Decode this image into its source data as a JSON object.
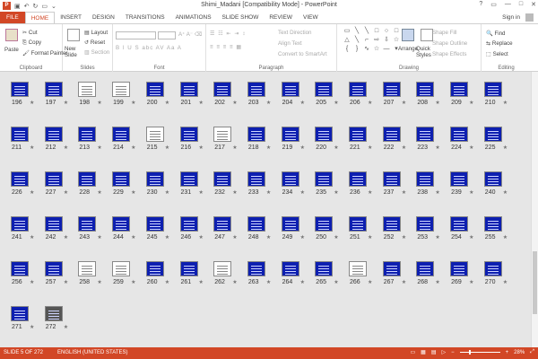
{
  "window": {
    "title": "Shimi_Madani [Compatibility Mode] - PowerPoint",
    "controls": [
      "?",
      "▭",
      "—",
      "□",
      "✕"
    ]
  },
  "tabs": [
    "FILE",
    "HOME",
    "INSERT",
    "DESIGN",
    "TRANSITIONS",
    "ANIMATIONS",
    "SLIDE SHOW",
    "REVIEW",
    "VIEW"
  ],
  "active_tab": "HOME",
  "sign_in": "Sign in",
  "ribbon": {
    "clipboard": {
      "paste": "Paste",
      "cut": "Cut",
      "copy": "Copy",
      "format_painter": "Format Painter",
      "group": "Clipboard"
    },
    "slides": {
      "new_slide": "New Slide",
      "layout": "Layout",
      "reset": "Reset",
      "section": "Section",
      "group": "Slides"
    },
    "font": {
      "group": "Font"
    },
    "paragraph": {
      "text_direction": "Text Direction",
      "align_text": "Align Text",
      "convert": "Convert to SmartArt",
      "group": "Paragraph"
    },
    "drawing": {
      "arrange": "Arrange",
      "quick_styles": "Quick Styles",
      "shape_fill": "Shape Fill",
      "shape_outline": "Shape Outline",
      "shape_effects": "Shape Effects",
      "group": "Drawing"
    },
    "editing": {
      "find": "Find",
      "replace": "Replace",
      "select": "Select",
      "group": "Editing"
    }
  },
  "slides": {
    "first": 196,
    "last": 272,
    "per_row": 15,
    "white_thumbs": [
      198,
      199,
      215,
      217,
      258,
      259,
      262,
      266
    ],
    "photo_thumbs": [
      272
    ]
  },
  "status": {
    "slide": "SLIDE 5 OF 272",
    "language": "ENGLISH (UNITED STATES)",
    "zoom": "28%"
  }
}
